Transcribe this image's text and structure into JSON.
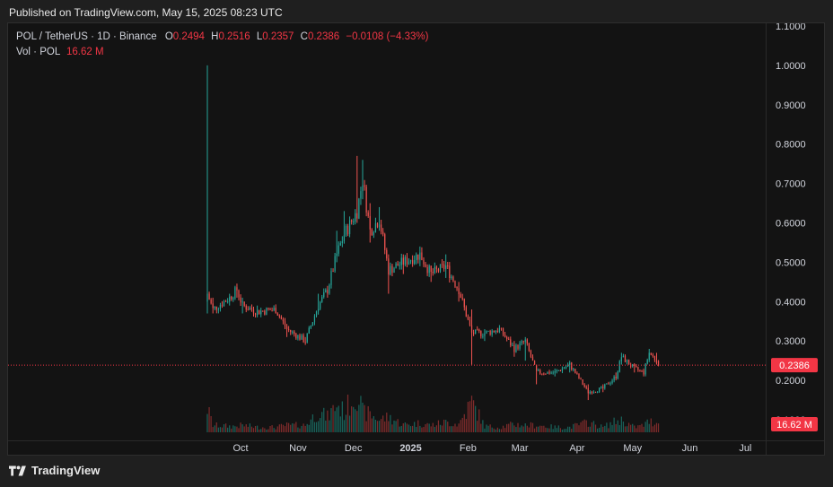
{
  "header": {
    "published": "Published on TradingView.com, May 15, 2025 08:23 UTC"
  },
  "legend": {
    "symbol": "POL / TetherUS · 1D · Binance",
    "o_label": "O",
    "o_value": "0.2494",
    "h_label": "H",
    "h_value": "0.2516",
    "l_label": "L",
    "l_value": "0.2357",
    "c_label": "C",
    "c_value": "0.2386",
    "change": "−0.0108 (−4.33%)",
    "vol_label": "Vol · POL",
    "vol_value": "16.62 M"
  },
  "footer": {
    "brand": "TradingView"
  },
  "colors": {
    "up": "#26a69a",
    "down": "#ef5350",
    "up_vol": "#1b6b63",
    "down_vol": "#8a2f2f",
    "price_badge": "#f23645",
    "grid": "#232323",
    "axis_text": "#d1d4dc"
  },
  "chart_data": {
    "type": "candlestick",
    "title": "",
    "xlabel": "",
    "ylabel": "",
    "ylim": [
      0.1,
      1.1
    ],
    "y_ticks": [
      "0.1000",
      "0.2000",
      "0.3000",
      "0.4000",
      "0.5000",
      "0.6000",
      "0.7000",
      "0.8000",
      "0.9000",
      "1.0000",
      "1.1000"
    ],
    "x_ticks": [
      "Oct",
      "Nov",
      "Dec",
      "2025",
      "Feb",
      "Mar",
      "Apr",
      "May",
      "Jun",
      "Jul"
    ],
    "x_tick_dates": [
      "2024-10-01",
      "2024-11-01",
      "2024-12-01",
      "2025-01-01",
      "2025-02-01",
      "2025-03-01",
      "2025-04-01",
      "2025-05-01",
      "2025-06-01",
      "2025-07-01"
    ],
    "x_range": [
      "2024-09-13",
      "2025-07-12"
    ],
    "grid": false,
    "last_price_label": "0.2386",
    "last_volume_label": "16.62 M",
    "anchors": [
      {
        "date": "2024-09-13",
        "close": 0.42,
        "high": 1.0,
        "low": 0.37,
        "vol": 48
      },
      {
        "date": "2024-09-16",
        "close": 0.38,
        "high": 0.41,
        "low": 0.37,
        "vol": 14
      },
      {
        "date": "2024-09-25",
        "close": 0.41,
        "high": 0.42,
        "low": 0.39,
        "vol": 12
      },
      {
        "date": "2024-09-29",
        "close": 0.43,
        "high": 0.44,
        "low": 0.41,
        "vol": 12
      },
      {
        "date": "2024-10-02",
        "close": 0.39,
        "high": 0.41,
        "low": 0.37,
        "vol": 14
      },
      {
        "date": "2024-10-10",
        "close": 0.375,
        "high": 0.39,
        "low": 0.36,
        "vol": 10
      },
      {
        "date": "2024-10-20",
        "close": 0.38,
        "high": 0.39,
        "low": 0.37,
        "vol": 10
      },
      {
        "date": "2024-10-26",
        "close": 0.33,
        "high": 0.34,
        "low": 0.31,
        "vol": 14
      },
      {
        "date": "2024-11-05",
        "close": 0.3,
        "high": 0.31,
        "low": 0.29,
        "vol": 14
      },
      {
        "date": "2024-11-12",
        "close": 0.39,
        "high": 0.42,
        "low": 0.37,
        "vol": 40
      },
      {
        "date": "2024-11-17",
        "close": 0.43,
        "high": 0.44,
        "low": 0.41,
        "vol": 30
      },
      {
        "date": "2024-11-22",
        "close": 0.52,
        "high": 0.58,
        "low": 0.5,
        "vol": 55
      },
      {
        "date": "2024-11-26",
        "close": 0.57,
        "high": 0.63,
        "low": 0.55,
        "vol": 40
      },
      {
        "date": "2024-12-03",
        "close": 0.63,
        "high": 0.77,
        "low": 0.6,
        "vol": 80
      },
      {
        "date": "2024-12-06",
        "close": 0.71,
        "high": 0.76,
        "low": 0.66,
        "vol": 40
      },
      {
        "date": "2024-12-10",
        "close": 0.58,
        "high": 0.65,
        "low": 0.55,
        "vol": 35
      },
      {
        "date": "2024-12-15",
        "close": 0.61,
        "high": 0.64,
        "low": 0.58,
        "vol": 25
      },
      {
        "date": "2024-12-20",
        "close": 0.48,
        "high": 0.52,
        "low": 0.42,
        "vol": 30
      },
      {
        "date": "2024-12-28",
        "close": 0.5,
        "high": 0.52,
        "low": 0.47,
        "vol": 15
      },
      {
        "date": "2025-01-06",
        "close": 0.52,
        "high": 0.54,
        "low": 0.49,
        "vol": 18
      },
      {
        "date": "2025-01-12",
        "close": 0.47,
        "high": 0.49,
        "low": 0.45,
        "vol": 14
      },
      {
        "date": "2025-01-20",
        "close": 0.49,
        "high": 0.52,
        "low": 0.46,
        "vol": 20
      },
      {
        "date": "2025-01-27",
        "close": 0.43,
        "high": 0.45,
        "low": 0.4,
        "vol": 16
      },
      {
        "date": "2025-02-03",
        "close": 0.32,
        "high": 0.38,
        "low": 0.24,
        "vol": 60
      },
      {
        "date": "2025-02-10",
        "close": 0.32,
        "high": 0.33,
        "low": 0.3,
        "vol": 12
      },
      {
        "date": "2025-02-18",
        "close": 0.33,
        "high": 0.34,
        "low": 0.32,
        "vol": 10
      },
      {
        "date": "2025-02-26",
        "close": 0.28,
        "high": 0.3,
        "low": 0.26,
        "vol": 16
      },
      {
        "date": "2025-03-04",
        "close": 0.3,
        "high": 0.31,
        "low": 0.25,
        "vol": 14
      },
      {
        "date": "2025-03-10",
        "close": 0.22,
        "high": 0.24,
        "low": 0.19,
        "vol": 14
      },
      {
        "date": "2025-03-20",
        "close": 0.22,
        "high": 0.23,
        "low": 0.21,
        "vol": 10
      },
      {
        "date": "2025-03-28",
        "close": 0.24,
        "high": 0.25,
        "low": 0.22,
        "vol": 10
      },
      {
        "date": "2025-04-07",
        "close": 0.17,
        "high": 0.19,
        "low": 0.15,
        "vol": 20
      },
      {
        "date": "2025-04-15",
        "close": 0.18,
        "high": 0.19,
        "low": 0.17,
        "vol": 10
      },
      {
        "date": "2025-04-22",
        "close": 0.21,
        "high": 0.22,
        "low": 0.2,
        "vol": 22
      },
      {
        "date": "2025-04-25",
        "close": 0.26,
        "high": 0.27,
        "low": 0.24,
        "vol": 24
      },
      {
        "date": "2025-05-02",
        "close": 0.23,
        "high": 0.24,
        "low": 0.22,
        "vol": 10
      },
      {
        "date": "2025-05-07",
        "close": 0.22,
        "high": 0.23,
        "low": 0.21,
        "vol": 14
      },
      {
        "date": "2025-05-10",
        "close": 0.27,
        "high": 0.28,
        "low": 0.25,
        "vol": 22
      },
      {
        "date": "2025-05-14",
        "close": 0.25,
        "high": 0.27,
        "low": 0.24,
        "vol": 18
      },
      {
        "date": "2025-05-15",
        "open": 0.2494,
        "high": 0.2516,
        "low": 0.2357,
        "close": 0.2386,
        "vol": 16.62
      }
    ]
  }
}
